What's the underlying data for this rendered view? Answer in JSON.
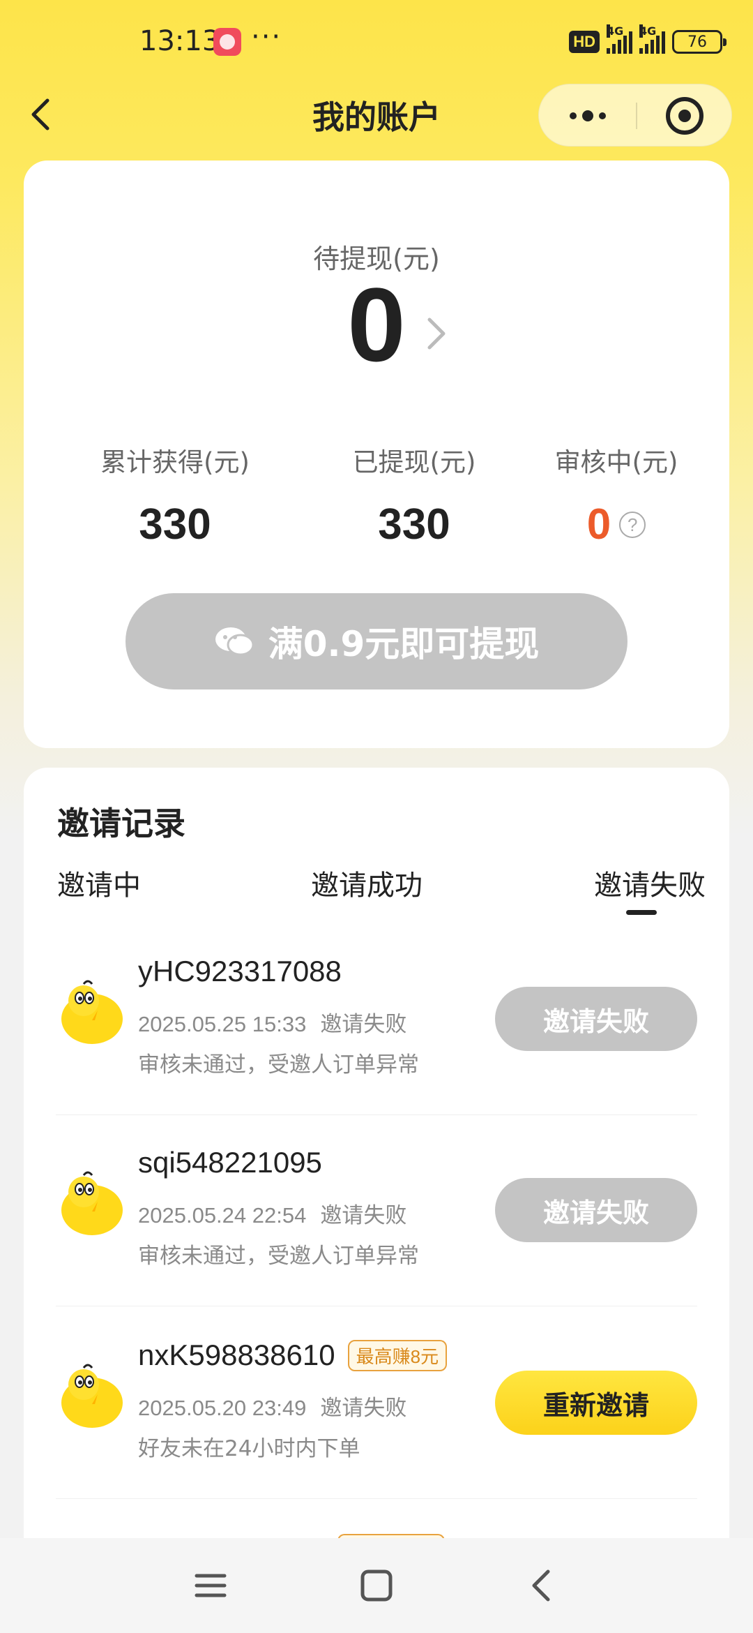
{
  "status_bar": {
    "time": "13:13",
    "dots": "···",
    "hd": "HD",
    "net1": "4G",
    "net2": "4G",
    "battery": "76"
  },
  "nav": {
    "title": "我的账户"
  },
  "balance": {
    "pending_label": "待提现(元)",
    "pending_value": "0",
    "stats": [
      {
        "label": "累计获得(元)",
        "value": "330"
      },
      {
        "label": "已提现(元)",
        "value": "330"
      },
      {
        "label": "审核中(元)",
        "value": "0"
      }
    ],
    "help": "?",
    "withdraw_label": "满0.9元即可提现"
  },
  "invite": {
    "title": "邀请记录",
    "tabs": [
      "邀请中",
      "邀请成功",
      "邀请失败"
    ],
    "active_tab": "邀请失败",
    "records": [
      {
        "name": "yHC923317088",
        "time": "2025.05.25 15:33",
        "status": "邀请失败",
        "reason": "审核未通过，受邀人订单异常",
        "action": "邀请失败",
        "tag": ""
      },
      {
        "name": "sqi548221095",
        "time": "2025.05.24 22:54",
        "status": "邀请失败",
        "reason": "审核未通过，受邀人订单异常",
        "action": "邀请失败",
        "tag": ""
      },
      {
        "name": "nxK598838610",
        "time": "2025.05.20 23:49",
        "status": "邀请失败",
        "reason": "好友未在24小时内下单",
        "action": "重新邀请",
        "tag": "最高赚8元"
      }
    ]
  },
  "colors": {
    "accent_yellow": "#fde44a",
    "red_value": "#ec5b2a",
    "disabled_gray": "#c4c4c4"
  },
  "icons": {
    "back": "back-arrow-icon",
    "more": "more-dots-icon",
    "close": "target-circle-icon",
    "wechat": "wechat-icon",
    "help": "question-circle-icon",
    "avatar": "yellow-chick-avatar"
  }
}
